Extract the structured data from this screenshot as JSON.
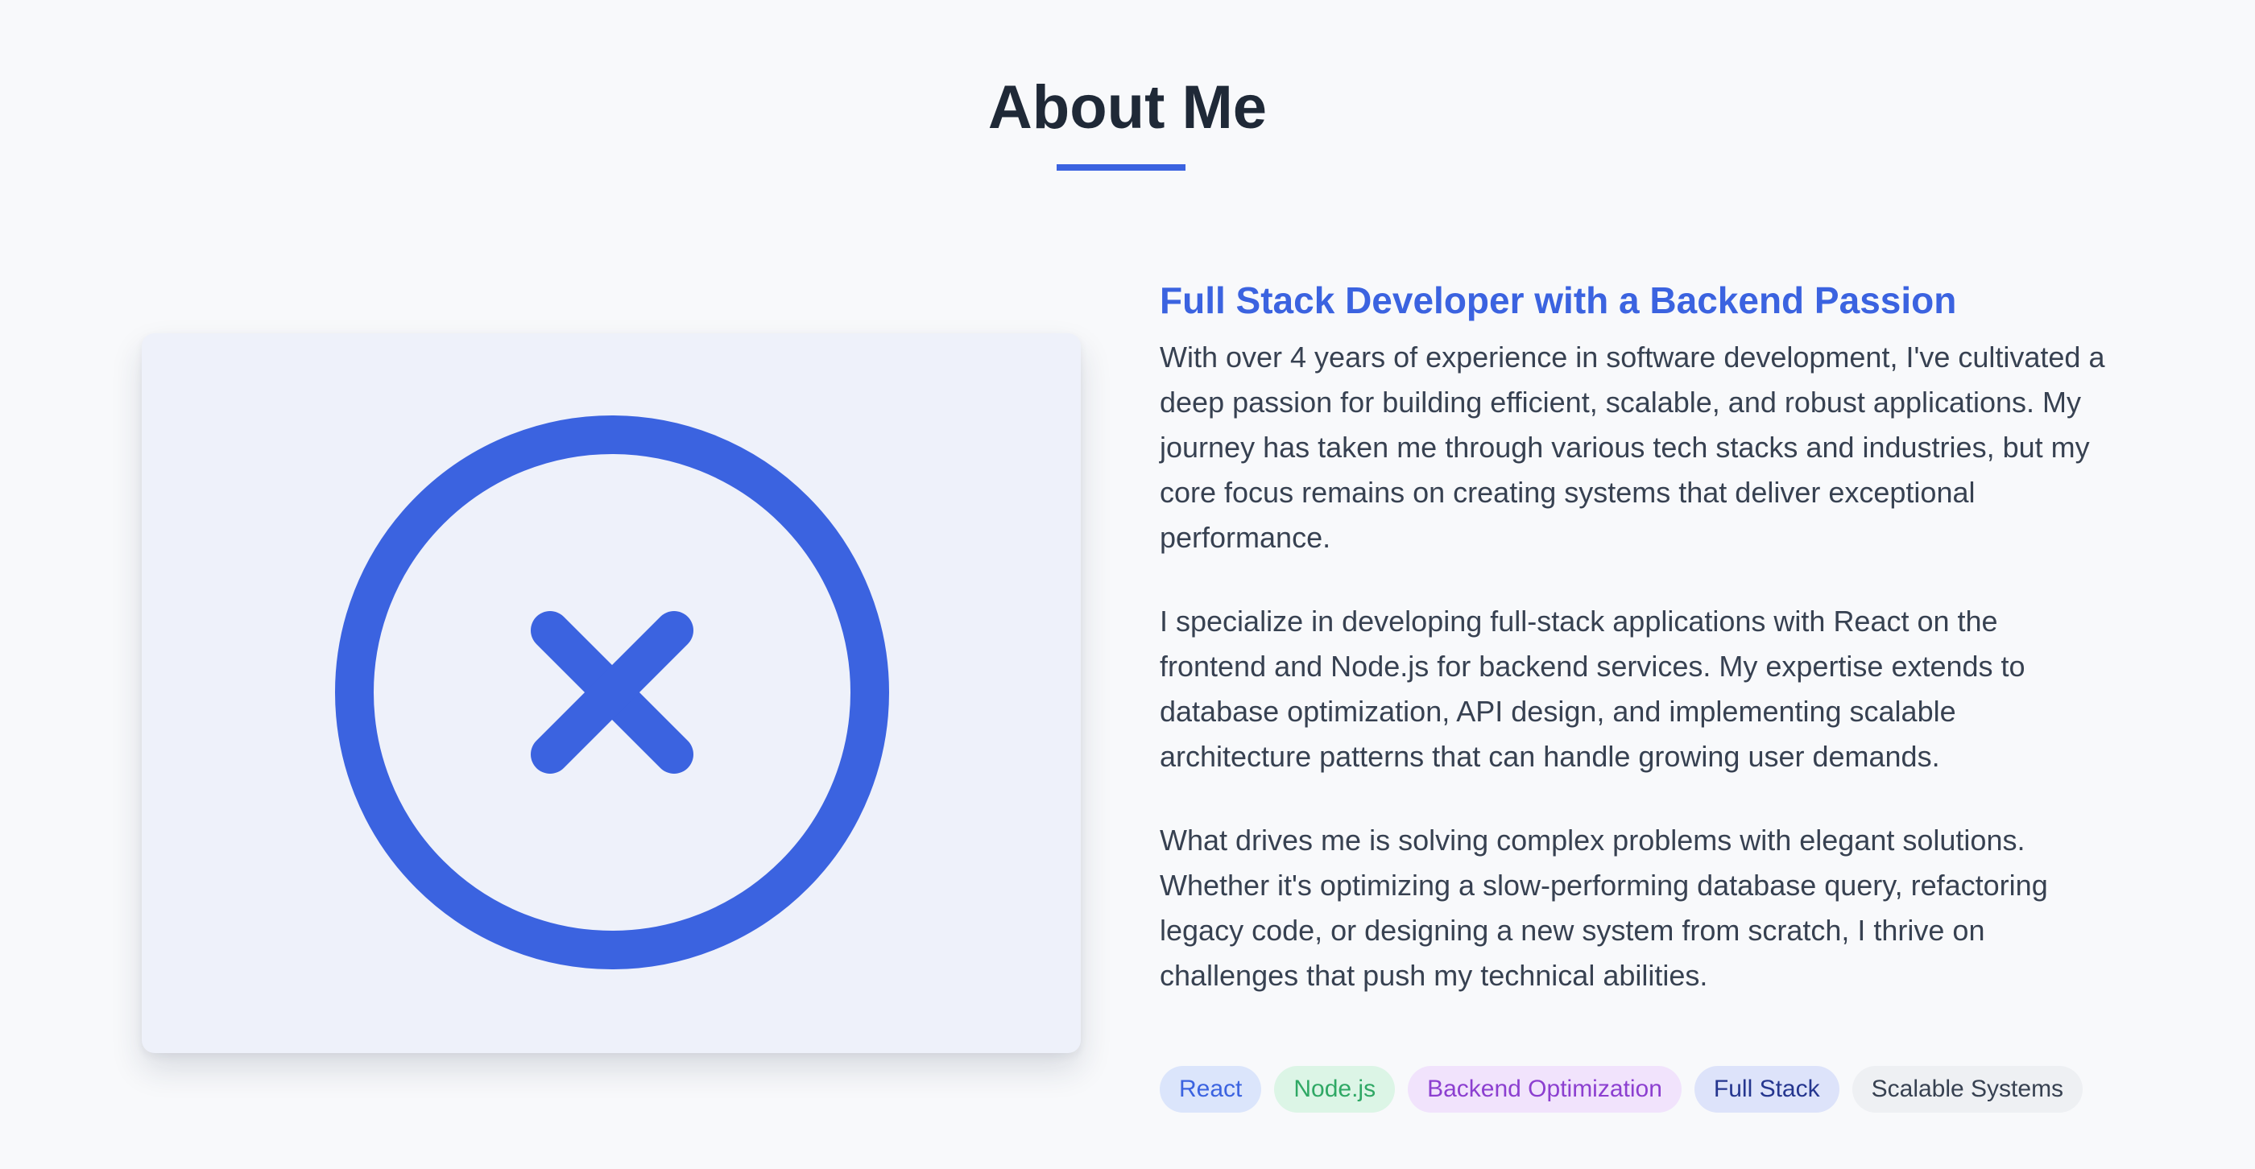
{
  "section": {
    "title": "About Me",
    "accent_color": "#3b63e0"
  },
  "image": {
    "icon": "circle-x-icon",
    "icon_color": "#3b63e0",
    "background_color": "#eef1fa"
  },
  "content": {
    "subtitle": "Full Stack Developer with a Backend Passion",
    "paragraphs": [
      "With over 4 years of experience in software development, I've cultivated a deep passion for building efficient, scalable, and robust applications. My journey has taken me through various tech stacks and industries, but my core focus remains on creating systems that deliver exceptional performance.",
      "I specialize in developing full-stack applications with React on the frontend and Node.js for backend services. My expertise extends to database optimization, API design, and implementing scalable architecture patterns that can handle growing user demands.",
      "What drives me is solving complex problems with elegant solutions. Whether it's optimizing a slow-performing database query, refactoring legacy code, or designing a new system from scratch, I thrive on challenges that push my technical abilities."
    ]
  },
  "tags": [
    {
      "label": "React",
      "bg": "#dbe5fb",
      "color": "#3b63e0"
    },
    {
      "label": "Node.js",
      "bg": "#dcf5e6",
      "color": "#2fa865"
    },
    {
      "label": "Backend Optimization",
      "bg": "#f1e3fc",
      "color": "#8c3fd0"
    },
    {
      "label": "Full Stack",
      "bg": "#dde3fa",
      "color": "#25368f"
    },
    {
      "label": "Scalable Systems",
      "bg": "#eef0f3",
      "color": "#374151"
    }
  ]
}
